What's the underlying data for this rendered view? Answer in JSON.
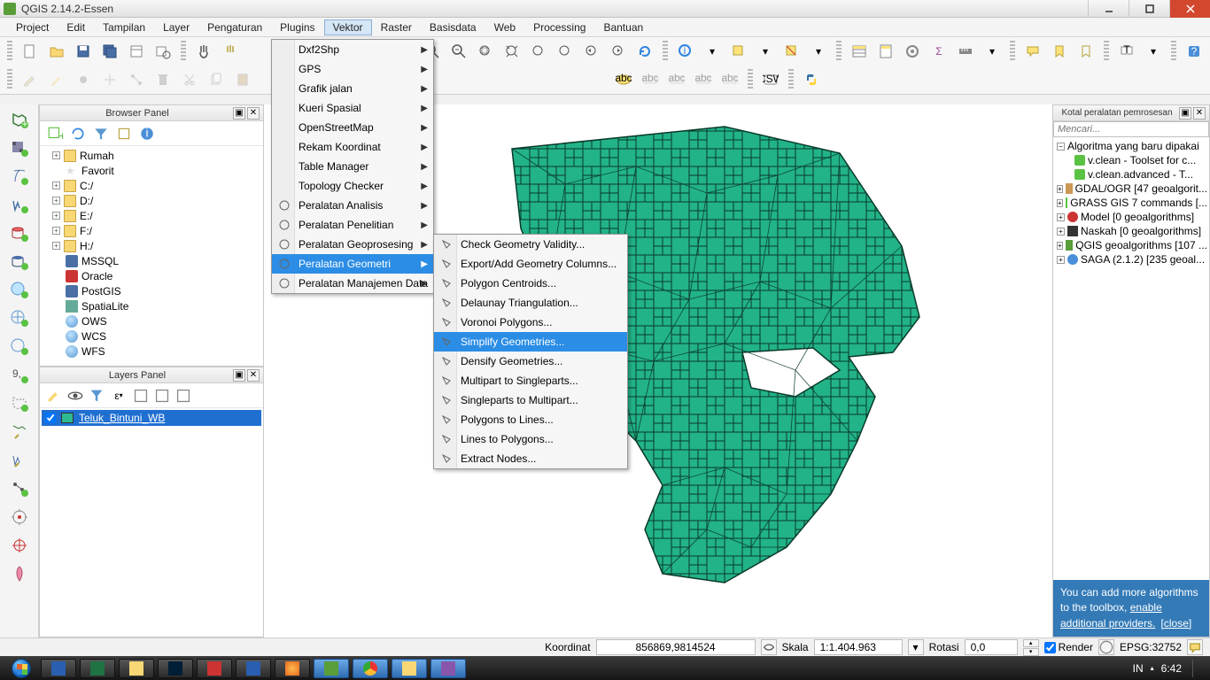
{
  "app": {
    "title": "QGIS 2.14.2-Essen"
  },
  "menubar": [
    "Project",
    "Edit",
    "Tampilan",
    "Layer",
    "Pengaturan",
    "Plugins",
    "Vektor",
    "Raster",
    "Basisdata",
    "Web",
    "Processing",
    "Bantuan"
  ],
  "vektor_menu": [
    {
      "label": "Dxf2Shp",
      "sub": true
    },
    {
      "label": "GPS",
      "sub": true
    },
    {
      "label": "Grafik jalan",
      "sub": true
    },
    {
      "label": "Kueri Spasial",
      "sub": true
    },
    {
      "label": "OpenStreetMap",
      "sub": true
    },
    {
      "label": "Rekam Koordinat",
      "sub": true
    },
    {
      "label": "Table Manager",
      "sub": true
    },
    {
      "label": "Topology Checker",
      "sub": true
    },
    {
      "label": "Peralatan Analisis",
      "sub": true,
      "icon": "analysis"
    },
    {
      "label": "Peralatan Penelitian",
      "sub": true,
      "icon": "research"
    },
    {
      "label": "Peralatan Geoprosesing",
      "sub": true,
      "icon": "gear"
    },
    {
      "label": "Peralatan Geometri",
      "sub": true,
      "icon": "geometry",
      "hl": true
    },
    {
      "label": "Peralatan Manajemen Data",
      "sub": true,
      "icon": "data"
    }
  ],
  "geom_submenu": [
    {
      "label": "Check Geometry Validity..."
    },
    {
      "label": "Export/Add Geometry Columns..."
    },
    {
      "label": "Polygon Centroids..."
    },
    {
      "label": "Delaunay Triangulation..."
    },
    {
      "label": "Voronoi Polygons..."
    },
    {
      "label": "Simplify Geometries...",
      "hl": true
    },
    {
      "label": "Densify Geometries..."
    },
    {
      "label": "Multipart to Singleparts..."
    },
    {
      "label": "Singleparts to Multipart..."
    },
    {
      "label": "Polygons to Lines..."
    },
    {
      "label": "Lines to Polygons..."
    },
    {
      "label": "Extract Nodes..."
    }
  ],
  "browser_panel": {
    "title": "Browser Panel",
    "items": [
      "Rumah",
      "Favorit",
      "C:/",
      "D:/",
      "E:/",
      "F:/",
      "H:/",
      "MSSQL",
      "Oracle",
      "PostGIS",
      "SpatiaLite",
      "OWS",
      "WCS",
      "WFS"
    ]
  },
  "layers_panel": {
    "title": "Layers Panel",
    "layer": "Teluk_Bintuni_WB"
  },
  "processing_panel": {
    "title": "Kotal peralatan pemrosesan",
    "search": "Mencari...",
    "root": "Algoritma yang baru dipakai",
    "recent": [
      "v.clean - Toolset for c...",
      "v.clean.advanced - T..."
    ],
    "items": [
      "GDAL/OGR [47 geoalgorit...",
      "GRASS GIS 7 commands [...",
      "Model [0 geoalgorithms]",
      "Naskah [0 geoalgorithms]",
      "QGIS geoalgorithms [107 ...",
      "SAGA (2.1.2) [235 geoal..."
    ],
    "tip_text": "You can add more algorithms to the toolbox, ",
    "tip_link": "enable additional providers.",
    "tip_close": "[close]"
  },
  "status": {
    "coord_label": "Koordinat",
    "coord": "856869,9814524",
    "scale_label": "Skala",
    "scale": "1:1.404.963",
    "rot_label": "Rotasi",
    "rot": "0,0",
    "render": "Render",
    "epsg": "EPSG:32752"
  },
  "system": {
    "lang": "IN",
    "time": "6:42"
  }
}
